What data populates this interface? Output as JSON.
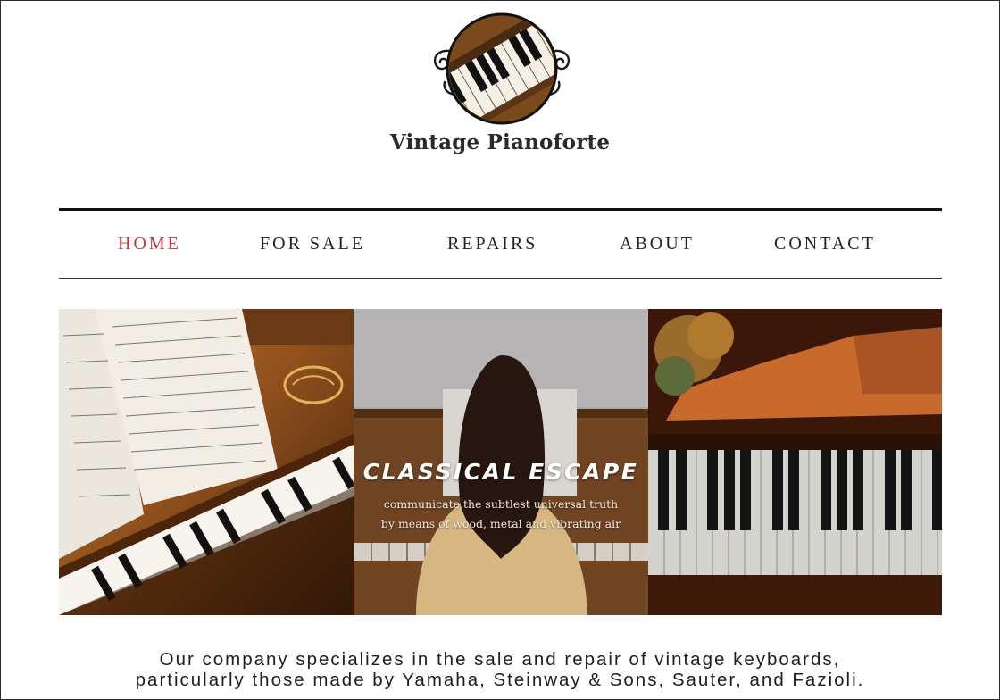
{
  "brand": {
    "name": "Vintage Pianoforte",
    "logo_icon": "piano-keys-emblem-icon"
  },
  "nav": {
    "items": [
      {
        "label": "HOME",
        "active": true
      },
      {
        "label": "FOR SALE",
        "active": false
      },
      {
        "label": "REPAIRS",
        "active": false
      },
      {
        "label": "ABOUT",
        "active": false
      },
      {
        "label": "CONTACT",
        "active": false
      }
    ],
    "active_color": "#c8323b"
  },
  "hero": {
    "title": "CLASSICAL ESCAPE",
    "subtitle_line1": "communicate the subtlest universal truth",
    "subtitle_line2": "by means of wood, metal and vibrating air"
  },
  "intro": {
    "line1": "Our company specializes in the sale and repair of vintage keyboards,",
    "line2": "particularly those made by Yamaha, Steinway & Sons, Sauter, and Fazioli."
  }
}
